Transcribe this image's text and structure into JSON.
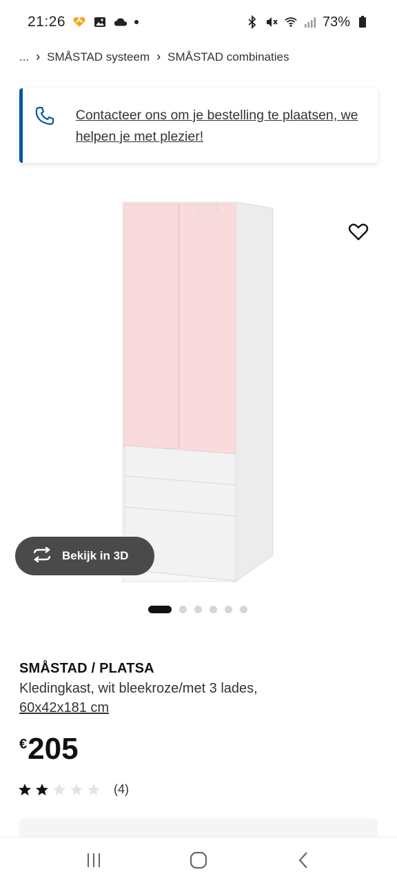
{
  "status_bar": {
    "time": "21:26",
    "battery": "73%",
    "icons_left": [
      "heart-app-icon",
      "image-icon",
      "cloud-icon",
      "dot-icon"
    ],
    "icons_right": [
      "bluetooth-icon",
      "mute-icon",
      "wifi-icon",
      "signal-icon",
      "battery-icon"
    ]
  },
  "breadcrumb": {
    "ellipsis": "...",
    "items": [
      "SMÅSTAD systeem",
      "SMÅSTAD combinaties"
    ]
  },
  "contact_banner": {
    "text": "Contacteer ons om je bestelling te plaatsen, we helpen je met plezier!",
    "accent_color": "#0058a3"
  },
  "media": {
    "view_3d_label": "Bekijk in 3D",
    "carousel": {
      "total": 6,
      "active_index": 0
    }
  },
  "product": {
    "name": "SMÅSTAD / PLATSA",
    "description": "Kledingkast, wit bleekroze/met 3 lades,",
    "size": "60x42x181 cm",
    "price_currency": "€",
    "price_value": "205",
    "rating": {
      "stars": 2,
      "max": 5,
      "count": "(4)"
    }
  },
  "nav_bar": {
    "buttons": [
      "recent-apps",
      "home",
      "back"
    ]
  }
}
